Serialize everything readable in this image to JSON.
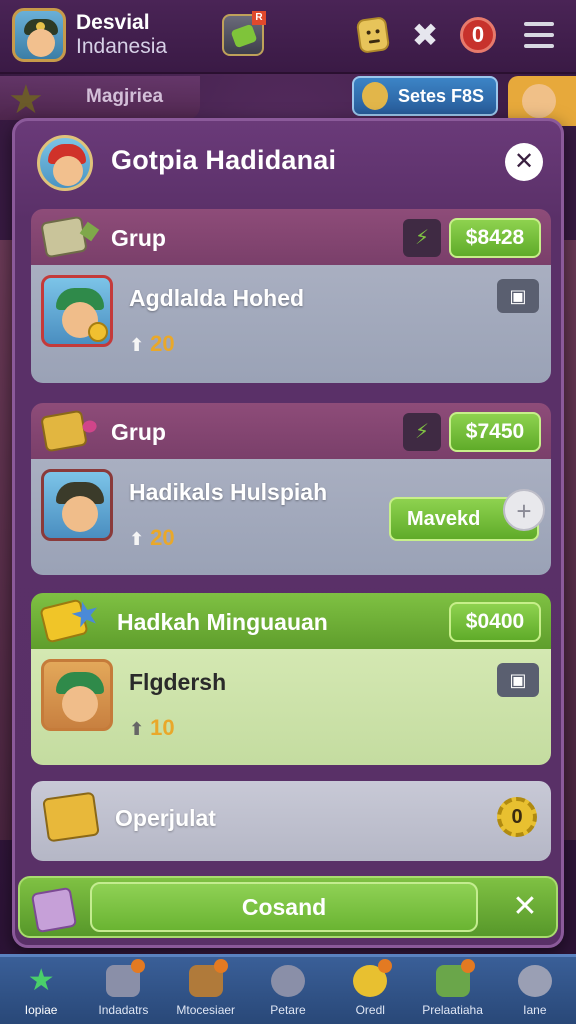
{
  "header": {
    "brand_line1": "Desvial",
    "brand_line2": "Indanesia",
    "chest_badge": "R",
    "counter": "0"
  },
  "background": {
    "left_tab_label": "Magjriea",
    "right_tab_label": "Setes F8S"
  },
  "modal": {
    "title": "Gotpia Hadidanai",
    "close_symbol": "✕"
  },
  "cards": [
    {
      "header_label": "Grup",
      "price": "$8428",
      "player_name": "Agdlalda Hohed",
      "score": "20",
      "mini_symbol": "⚡"
    },
    {
      "header_label": "Grup",
      "price": "$7450",
      "player_name": "Hadikals Hulspiah",
      "score": "20",
      "action_label": "Mavekd",
      "mini_symbol": "⚡"
    },
    {
      "header_label": "Hadkah Minguauan",
      "price": "$0400",
      "player_name": "Flgdersh",
      "score": "10"
    },
    {
      "label": "Operjulat"
    }
  ],
  "command_bar": {
    "label": "Cosand",
    "close_symbol": "✕"
  },
  "bottom_nav": [
    {
      "label": "Iopiae",
      "active": true
    },
    {
      "label": "Indadatrs"
    },
    {
      "label": "Mtocesiaer"
    },
    {
      "label": "Petare"
    },
    {
      "label": "Oredl"
    },
    {
      "label": "Prelaatiaha"
    },
    {
      "label": "Iane"
    }
  ],
  "colors": {
    "primary_green": "#6ab432",
    "panel_purple": "#5a3068",
    "nav_blue": "#294878",
    "accent_gold": "#e9a82a"
  }
}
